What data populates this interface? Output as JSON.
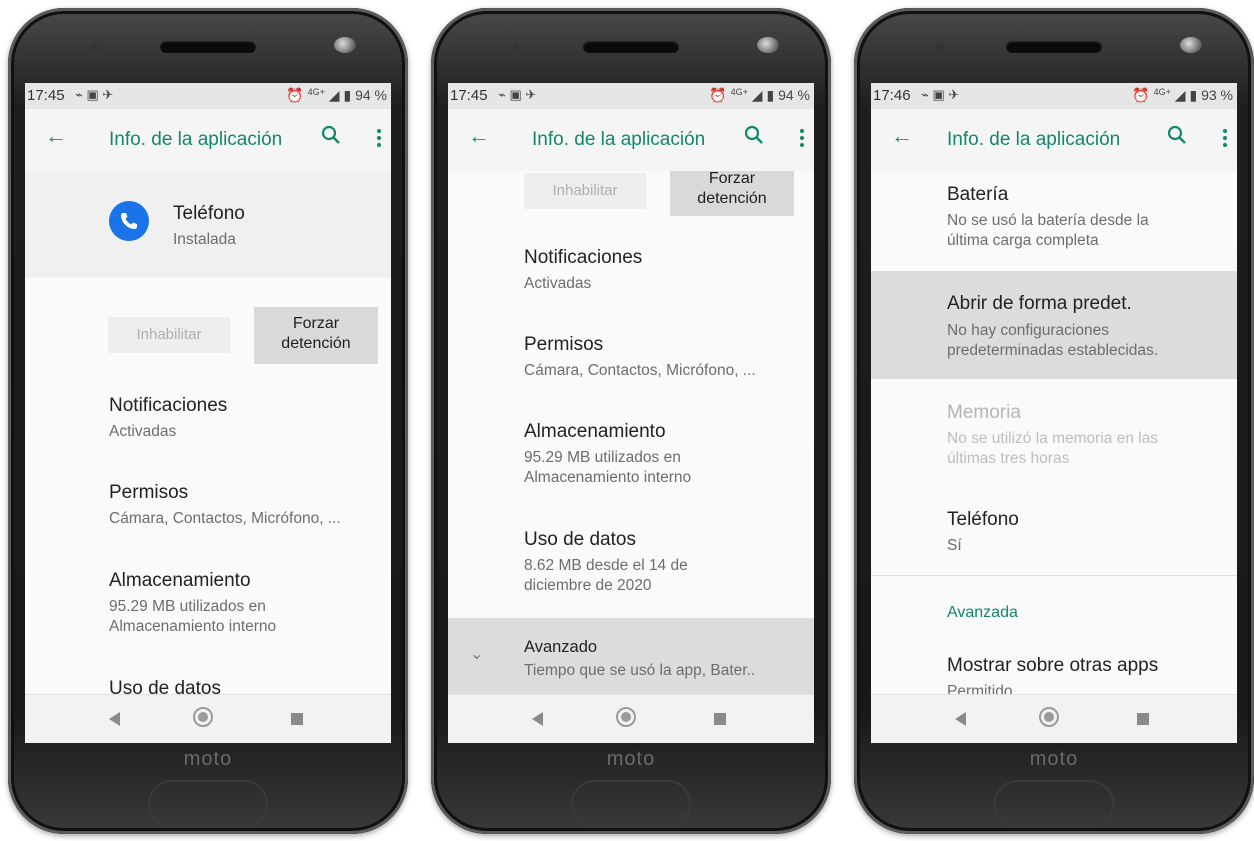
{
  "logo": "moto",
  "colors": {
    "accent": "#12876c",
    "highlight": "#dcdcdc",
    "phone_icon": "#1a73e8"
  },
  "phones": [
    {
      "status": {
        "time": "17:45",
        "battery": "94 %",
        "network": "4G+"
      },
      "appbar": {
        "title": "Info. de la aplicación"
      },
      "app": {
        "name": "Teléfono",
        "state": "Instalada"
      },
      "buttons": {
        "disable": "Inhabilitar",
        "force_stop": "Forzar\ndetención"
      },
      "items": [
        {
          "title": "Notificaciones",
          "subtitle": "Activadas"
        },
        {
          "title": "Permisos",
          "subtitle": "Cámara, Contactos, Micrófono, ..."
        },
        {
          "title": "Almacenamiento",
          "subtitle": "95.29 MB utilizados en\nAlmacenamiento interno"
        },
        {
          "title": "Uso de datos",
          "subtitle": ""
        }
      ]
    },
    {
      "status": {
        "time": "17:45",
        "battery": "94 %",
        "network": "4G+"
      },
      "appbar": {
        "title": "Info. de la aplicación"
      },
      "buttons": {
        "disable": "Inhabilitar",
        "force_stop": "Forzar\ndetención"
      },
      "items": [
        {
          "title": "Notificaciones",
          "subtitle": "Activadas"
        },
        {
          "title": "Permisos",
          "subtitle": "Cámara, Contactos, Micrófono, ..."
        },
        {
          "title": "Almacenamiento",
          "subtitle": "95.29 MB utilizados en\nAlmacenamiento interno"
        },
        {
          "title": "Uso de datos",
          "subtitle": "8.62 MB desde el 14 de\ndiciembre de 2020"
        },
        {
          "title": "Avanzado",
          "subtitle": "Tiempo que se usó la app, Bater.."
        }
      ]
    },
    {
      "status": {
        "time": "17:46",
        "battery": "93 %",
        "network": "4G+"
      },
      "appbar": {
        "title": "Info. de la aplicación"
      },
      "items": [
        {
          "title": "Batería",
          "subtitle": "No se usó la batería desde la\núltima carga completa"
        },
        {
          "title": "Abrir de forma predet.",
          "subtitle": "No hay configuraciones\npredeterminadas establecidas."
        },
        {
          "title": "Memoria",
          "subtitle": "No se utilizó la memoria en las\núltimas tres horas"
        },
        {
          "title": "Teléfono",
          "subtitle": "Sí"
        },
        {
          "title": "Mostrar sobre otras apps",
          "subtitle": "Permitido"
        }
      ],
      "section": "Avanzada"
    }
  ]
}
